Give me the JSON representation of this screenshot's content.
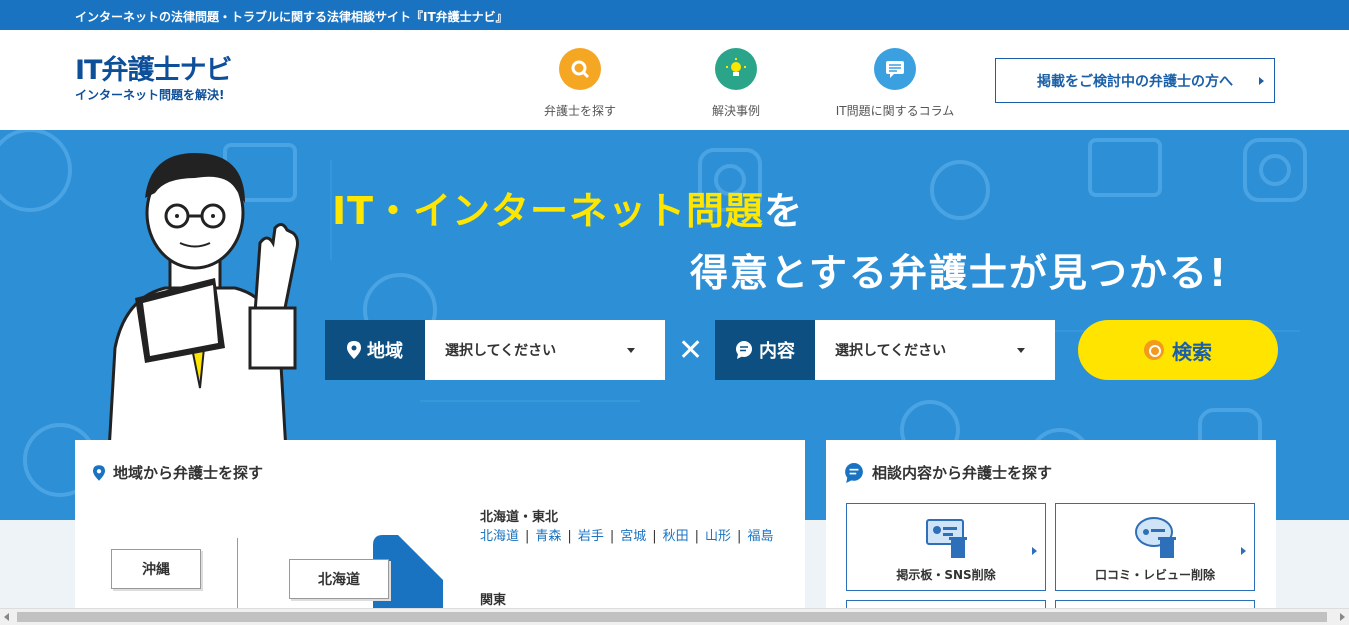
{
  "topbar": {
    "text": "インターネットの法律問題・トラブルに関する法律相談サイト『IT弁護士ナビ』"
  },
  "logo": {
    "main": "IT弁護士ナビ",
    "sub": "インターネット問題を解決!"
  },
  "nav": [
    {
      "label": "弁護士を探す",
      "icon": "search-icon",
      "color": "#f5a623"
    },
    {
      "label": "解決事例",
      "icon": "lightbulb-icon",
      "color": "#2aa58a"
    },
    {
      "label": "IT問題に関するコラム",
      "icon": "chat-bubble-icon",
      "color": "#3aa0e0"
    }
  ],
  "cta": {
    "label": "掲載をご検討中の弁護士の方へ"
  },
  "hero": {
    "headline1_highlight": "IT・インターネット問題",
    "headline1_rest": "を",
    "headline2": "得意とする弁護士が見つかる!",
    "region_label": "地域",
    "region_placeholder": "選択してください",
    "content_label": "内容",
    "content_placeholder": "選択してください",
    "times": "✕",
    "search_label": "検索"
  },
  "region_panel": {
    "title": "地域から弁護士を探す",
    "okinawa": "沖縄",
    "hokkaido": "北海道",
    "heading1": "北海道・東北",
    "prefs": [
      "北海道",
      "青森",
      "岩手",
      "宮城",
      "秋田",
      "山形",
      "福島"
    ],
    "heading2": "関東"
  },
  "category_panel": {
    "title": "相談内容から弁護士を探す",
    "cards": [
      {
        "label": "掲示板・SNS削除",
        "icon": "board-delete-icon"
      },
      {
        "label": "口コミ・レビュー削除",
        "icon": "review-delete-icon"
      }
    ]
  },
  "colors": {
    "brand": "#0d4f99",
    "hero": "#2d8fd5",
    "yellow": "#ffe600"
  }
}
